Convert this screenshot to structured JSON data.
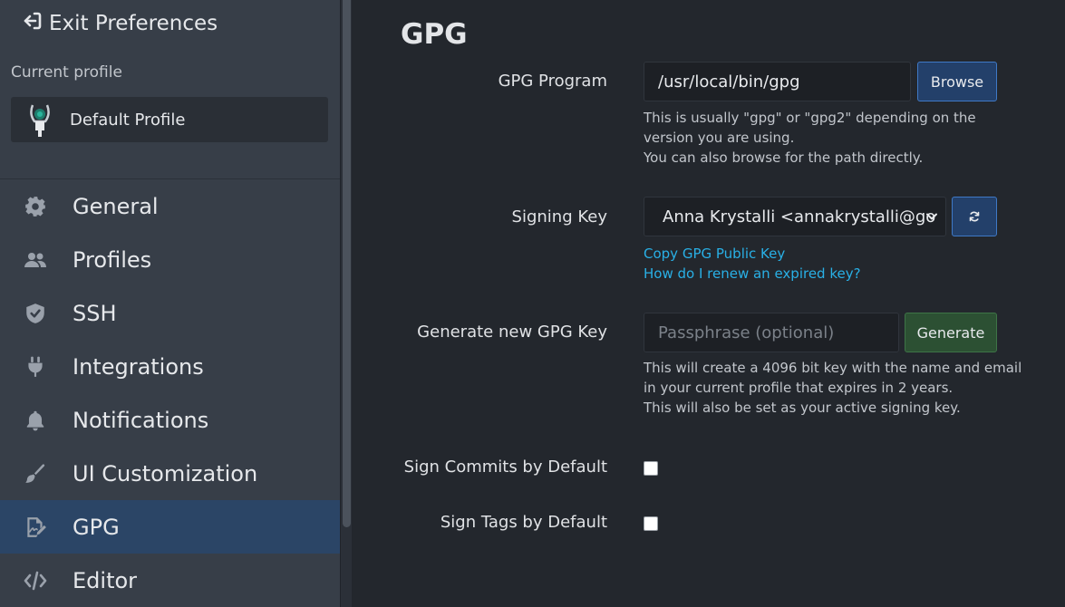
{
  "sidebar": {
    "exit_label": "Exit Preferences",
    "profile_caption": "Current profile",
    "profile_name": "Default Profile",
    "items": [
      {
        "label": "General",
        "icon": "gear-icon"
      },
      {
        "label": "Profiles",
        "icon": "users-icon"
      },
      {
        "label": "SSH",
        "icon": "shield-icon"
      },
      {
        "label": "Integrations",
        "icon": "plug-icon"
      },
      {
        "label": "Notifications",
        "icon": "bell-icon"
      },
      {
        "label": "UI Customization",
        "icon": "paintbrush-icon"
      },
      {
        "label": "GPG",
        "icon": "signature-icon",
        "active": true
      },
      {
        "label": "Editor",
        "icon": "code-icon"
      }
    ]
  },
  "main": {
    "title": "GPG",
    "gpg_program": {
      "label": "GPG Program",
      "value": "/usr/local/bin/gpg",
      "browse_label": "Browse",
      "help": [
        "This is usually \"gpg\" or \"gpg2\" depending on the",
        "version you are using.",
        "You can also browse for the path directly."
      ]
    },
    "signing_key": {
      "label": "Signing Key",
      "selected": "Anna Krystalli <annakrystalli@go",
      "copy_link": "Copy GPG Public Key",
      "renew_link": "How do I renew an expired key?"
    },
    "generate": {
      "label": "Generate new GPG Key",
      "placeholder": "Passphrase (optional)",
      "button_label": "Generate",
      "help": [
        "This will create a 4096 bit key with the name and email",
        "in your current profile that expires in 2 years.",
        "This will also be set as your active signing key."
      ]
    },
    "sign_commits": {
      "label": "Sign Commits by Default",
      "checked": false
    },
    "sign_tags": {
      "label": "Sign Tags by Default",
      "checked": false
    }
  },
  "colors": {
    "sidebar_bg": "#373e48",
    "main_bg": "#23272d",
    "active_item": "#2b4566",
    "link": "#29b0e6",
    "blue_button": "#23406a",
    "green_button": "#2c5033"
  }
}
